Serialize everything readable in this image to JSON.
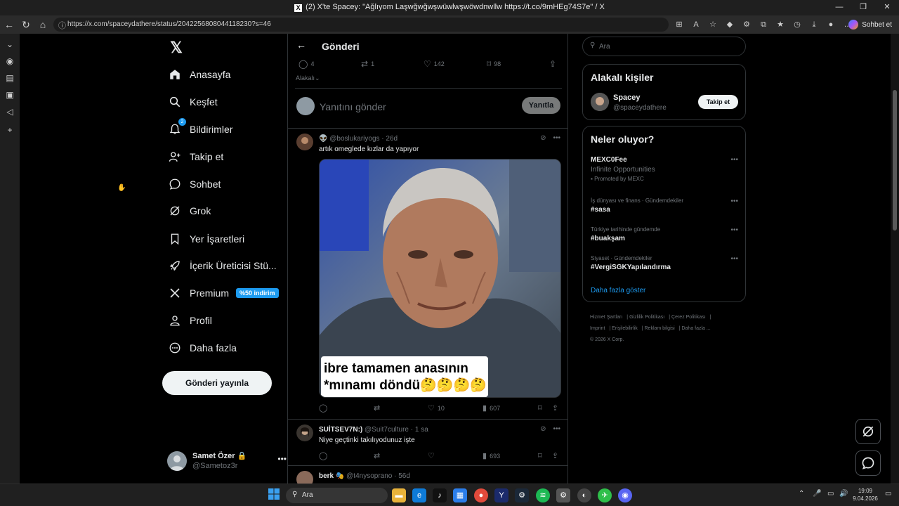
{
  "browser": {
    "window_title": "(2) X'te Spacey: \"Ağlıyom Laşwğwğwşwüwlwşwöwdnwllw https://t.co/9mHEg74S7e\" / X",
    "url": "https://x.com/spaceydathere/status/2042256808044118230?s=46",
    "copilot_label": "Sohbet et"
  },
  "sidebar": {
    "items": [
      {
        "label": "Anasayfa",
        "icon": "home-icon"
      },
      {
        "label": "Keşfet",
        "icon": "search-icon"
      },
      {
        "label": "Bildirimler",
        "icon": "bell-icon",
        "badge": "2"
      },
      {
        "label": "Takip et",
        "icon": "follow-icon"
      },
      {
        "label": "Sohbet",
        "icon": "chat-icon"
      },
      {
        "label": "Grok",
        "icon": "grok-icon"
      },
      {
        "label": "Yer İşaretleri",
        "icon": "bookmark-icon"
      },
      {
        "label": "İçerik Üreticisi Stü...",
        "icon": "rocket-icon"
      },
      {
        "label": "Premium",
        "icon": "x-icon",
        "promo": "%50 indirim"
      },
      {
        "label": "Profil",
        "icon": "profile-icon"
      },
      {
        "label": "Daha fazla",
        "icon": "more-icon"
      }
    ],
    "post_button": "Gönderi yayınla",
    "account": {
      "name": "Samet Özer",
      "handle": "@Sametoz3r"
    }
  },
  "post": {
    "header": "Gönderi",
    "stats": {
      "replies": "4",
      "reposts": "1",
      "likes": "142",
      "bookmarks": "98"
    },
    "related_label": "Alakalı",
    "reply_placeholder": "Yanıtını gönder",
    "reply_button": "Yanıtla"
  },
  "replies": [
    {
      "name": "",
      "handle": "@boslukariyogs",
      "time": "26d",
      "text": "artık omeglede kızlar da yapıyor",
      "media_caption_line1": "ibre tamamen anasının",
      "media_caption_line2": "*mınamı döndü🤔🤔🤔🤔",
      "likes": "10",
      "views": "607"
    },
    {
      "name": "SUİTSEV7N:)",
      "handle": "@Suit7culture",
      "time": "1 sa",
      "text": "Niye geçtinki takılıyodunuz işte",
      "views": "693"
    },
    {
      "name": "berk",
      "handle": "@t4nysoprano",
      "time": "56d"
    }
  ],
  "right": {
    "search_placeholder": "Ara",
    "related_people_title": "Alakalı kişiler",
    "person": {
      "name": "Spacey",
      "handle": "@spaceydathere",
      "follow_label": "Takip et"
    },
    "trends_title": "Neler oluyor?",
    "trends": [
      {
        "context": "",
        "name": "MEXC0Fee",
        "sub": "Infinite Opportunities",
        "promo": "Promoted by MEXC"
      },
      {
        "context": "İş dünyası ve finans · Gündemdekiler",
        "name": "#sasa"
      },
      {
        "context": "Türkiye tarihinde gündemde",
        "name": "#buakşam"
      },
      {
        "context": "Siyaset · Gündemdekiler",
        "name": "#VergiSGKYapılandırma"
      }
    ],
    "show_more": "Daha fazla göster",
    "footer": [
      "Hizmet Şartları",
      "Gizlilik Politikası",
      "Çerez Politikası",
      "Imprint",
      "Erişilebilirlik",
      "Reklam bilgisi",
      "Daha fazla ...",
      "© 2026 X Corp."
    ]
  },
  "taskbar": {
    "search_placeholder": "Ara",
    "time": "19:09",
    "date": "9.04.2026"
  },
  "colors": {
    "accent": "#1d9bf0",
    "background": "#000000",
    "border": "#2f3336",
    "muted": "#71767b"
  }
}
